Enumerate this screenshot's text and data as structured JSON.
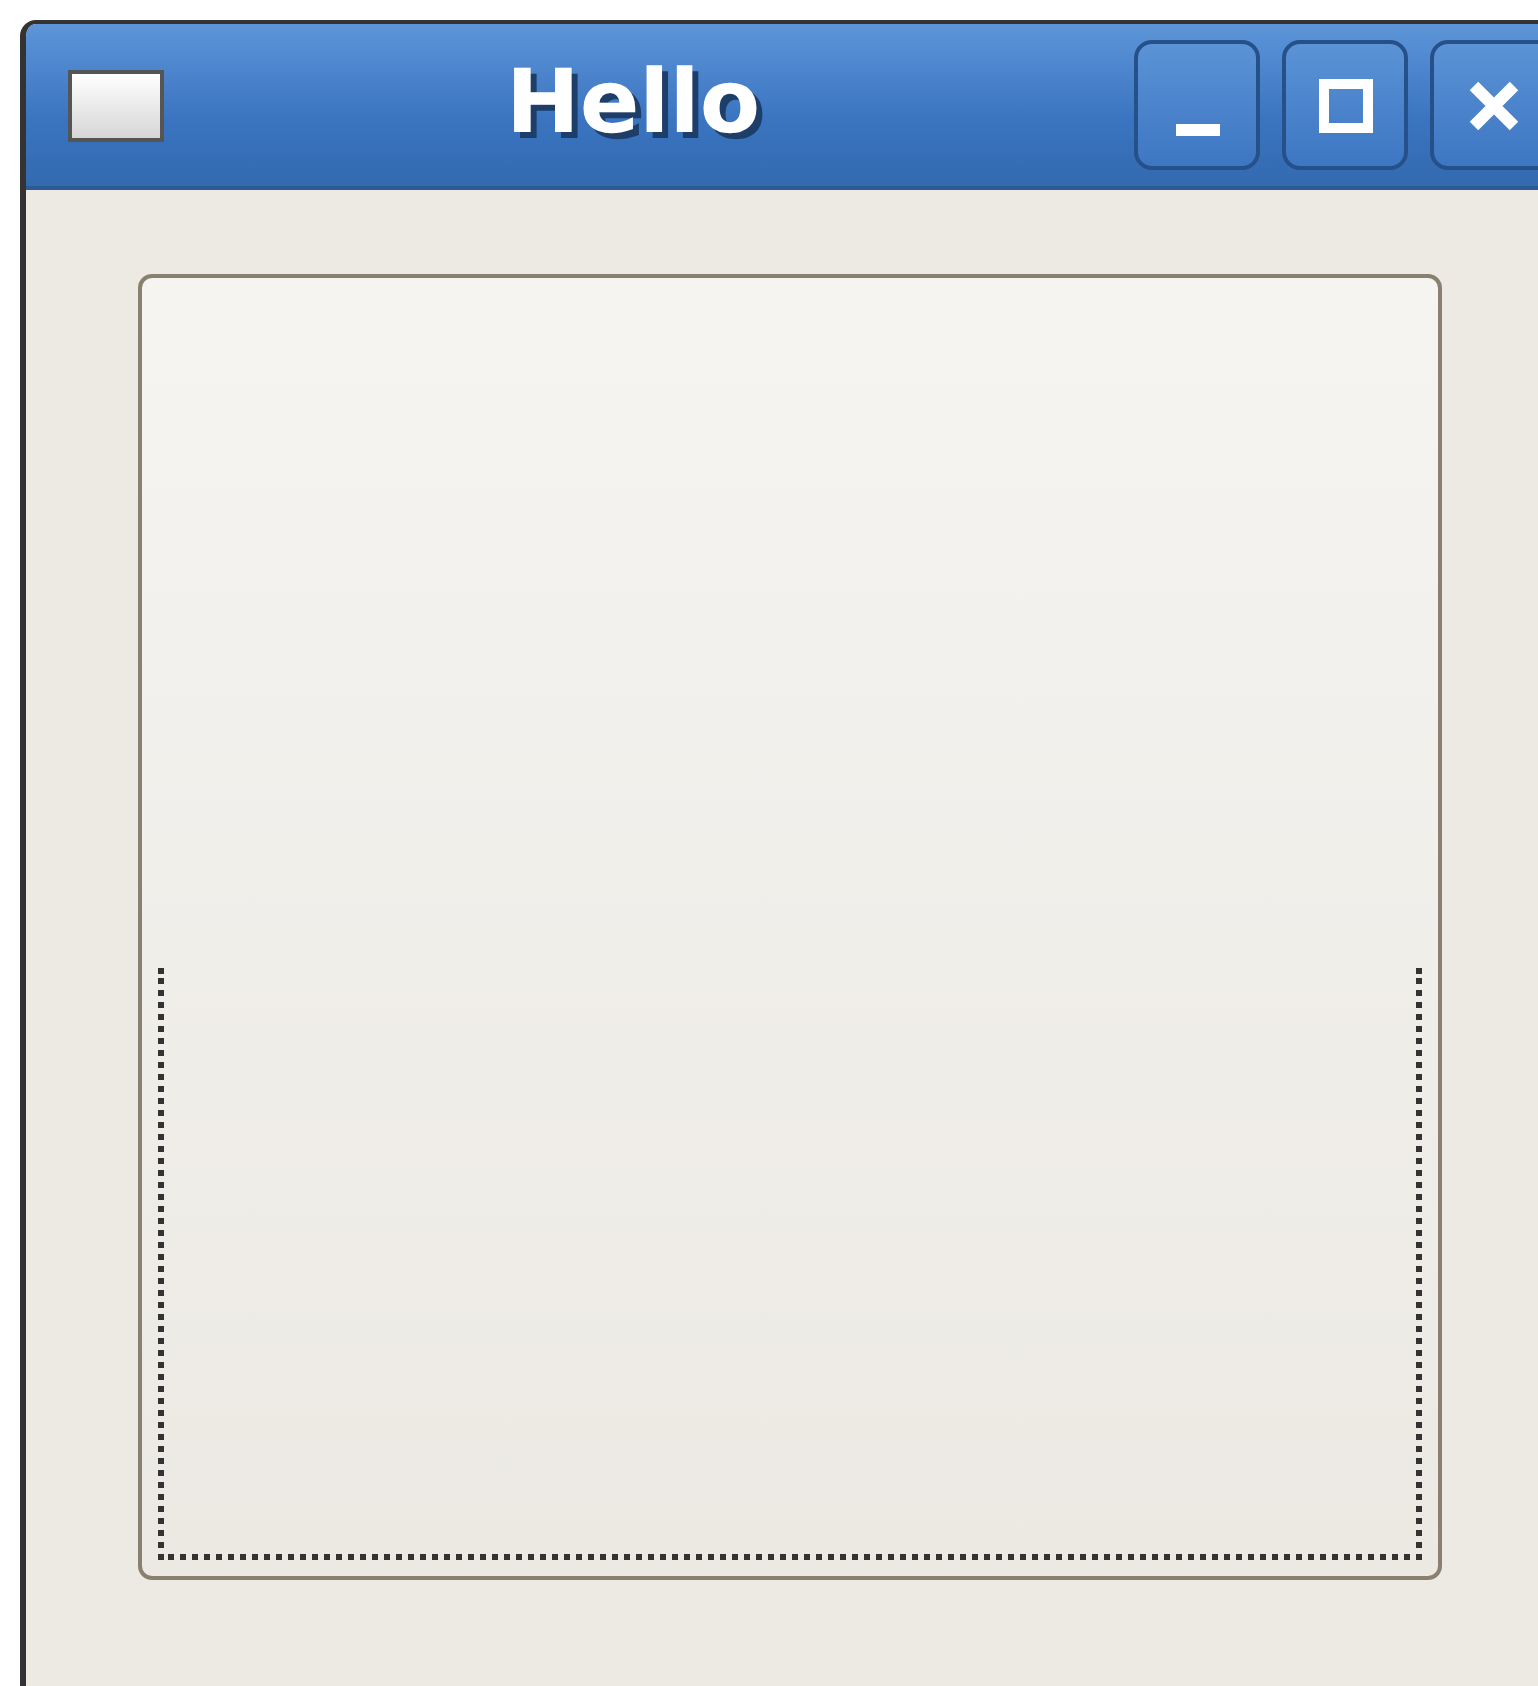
{
  "window": {
    "title": "Hello"
  },
  "button": {
    "focused": true
  }
}
